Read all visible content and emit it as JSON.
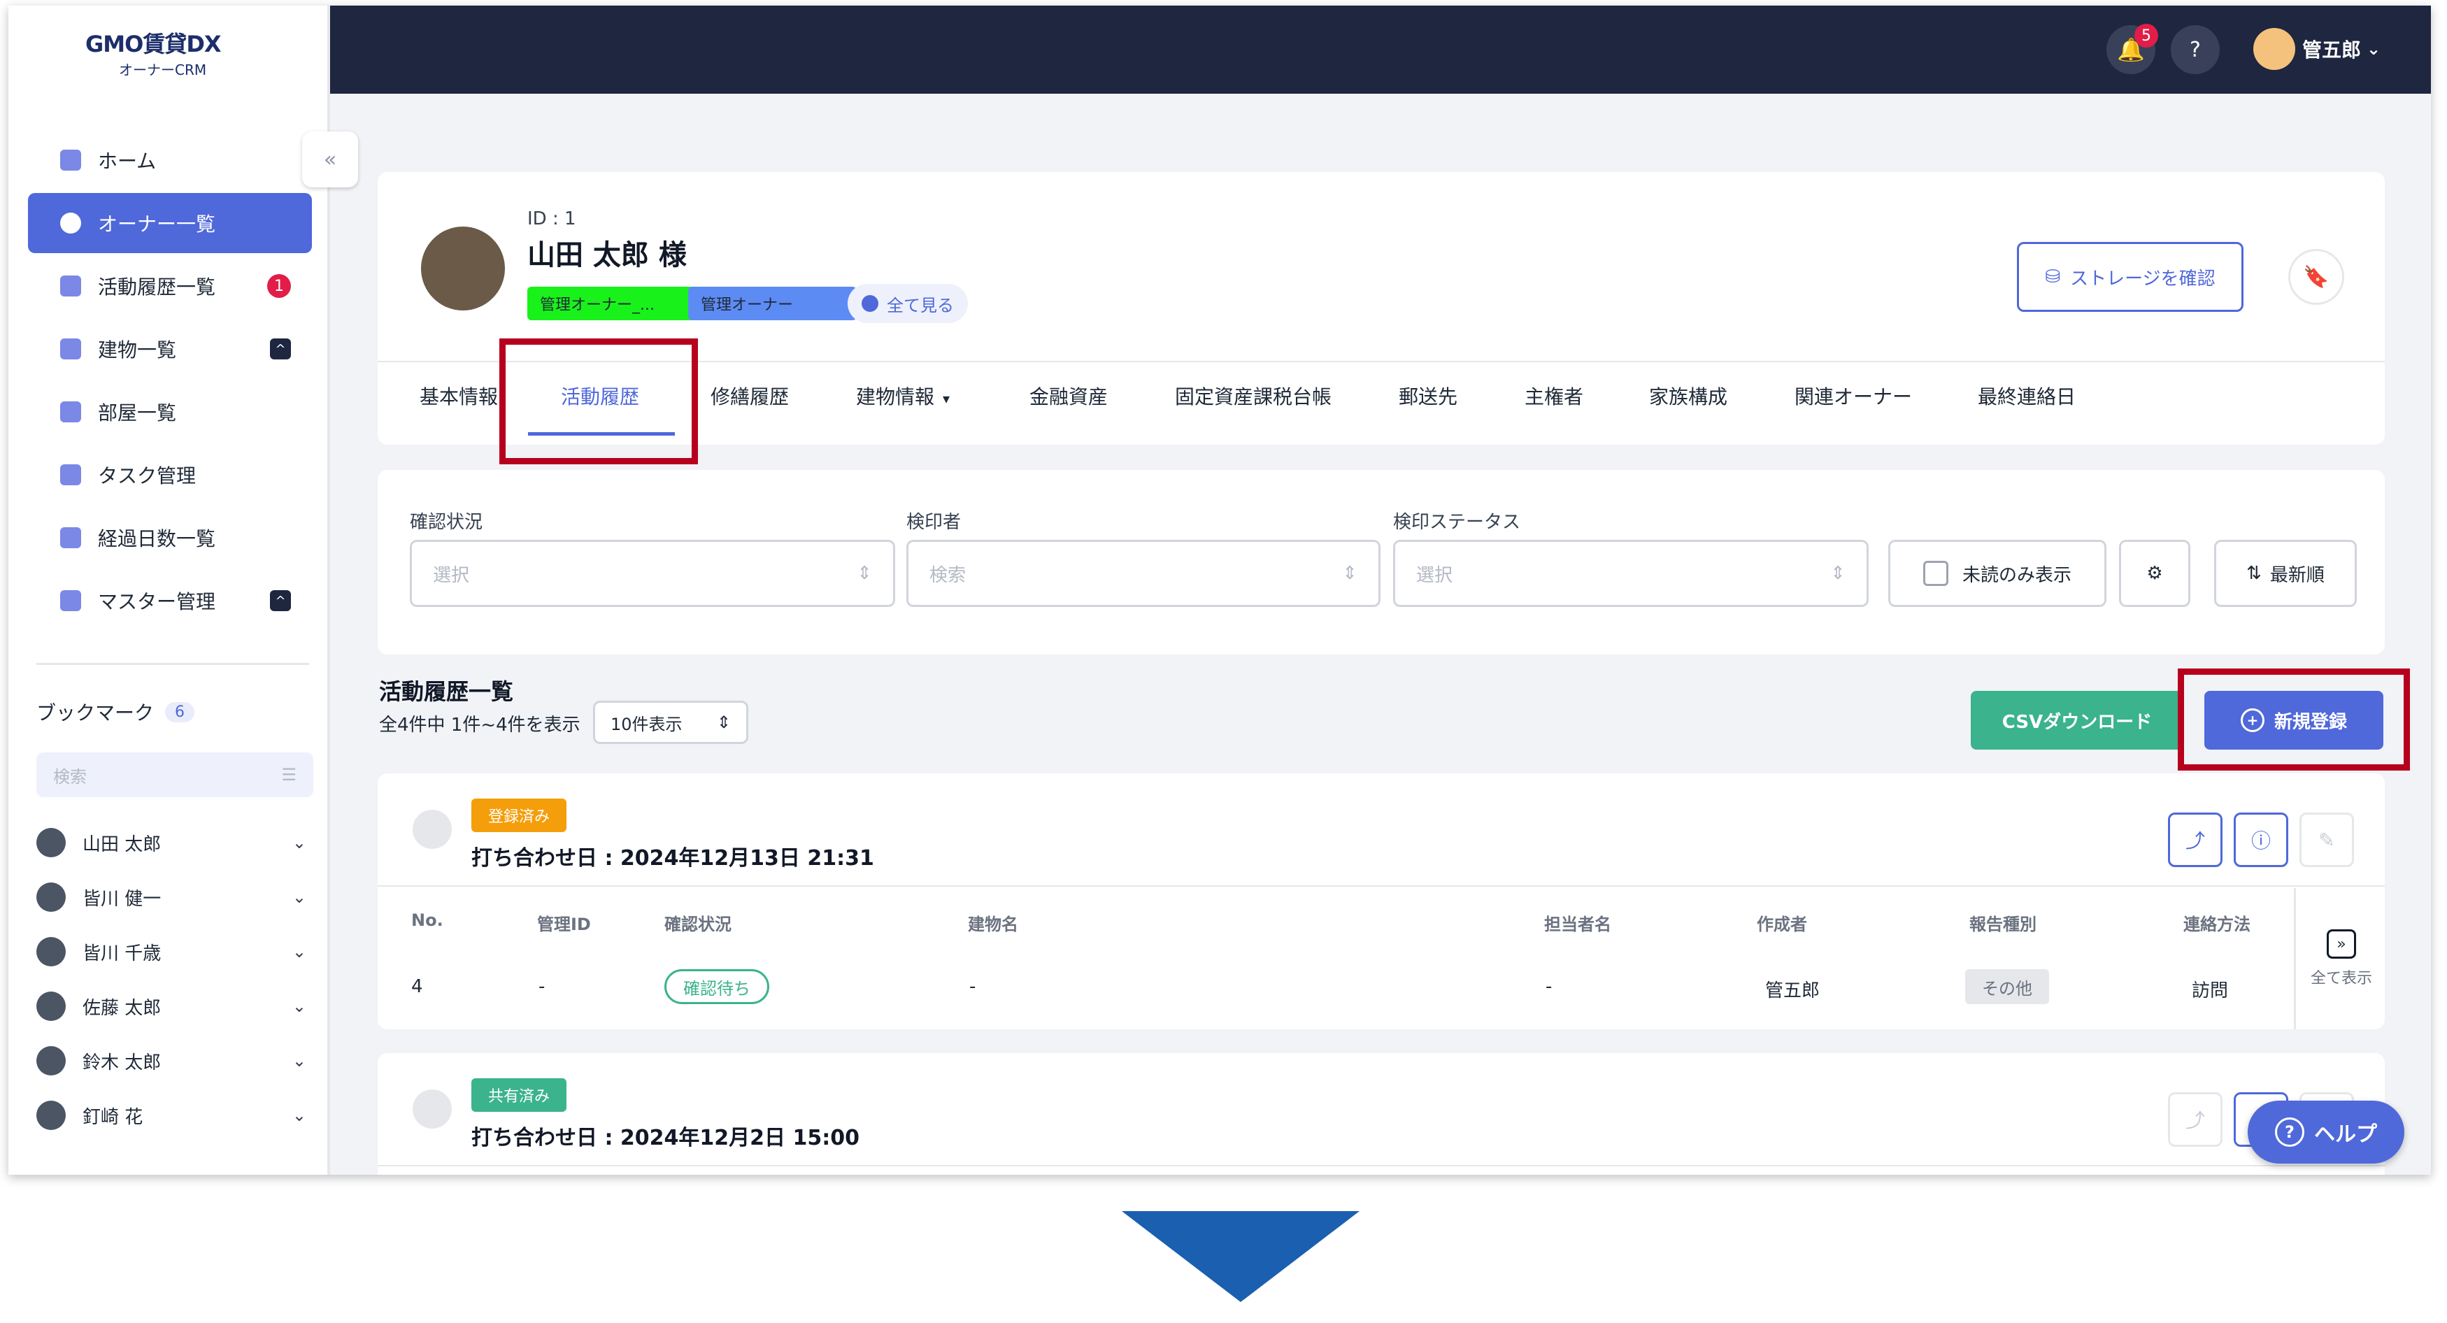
{
  "brand": {
    "logo": "GMO",
    "name": "賃貸DX",
    "sub": "オーナーCRM"
  },
  "sidebar": {
    "items": [
      {
        "label": "ホーム"
      },
      {
        "label": "オーナー一覧"
      },
      {
        "label": "活動履歴一覧",
        "badge": "1"
      },
      {
        "label": "建物一覧",
        "badge": "^"
      },
      {
        "label": "部屋一覧"
      },
      {
        "label": "タスク管理"
      },
      {
        "label": "経過日数一覧"
      },
      {
        "label": "マスター管理",
        "badge": "^"
      }
    ],
    "bookmarks_title": "ブックマーク",
    "bookmarks_count": "6",
    "search_placeholder": "検索",
    "bookmarks": [
      {
        "name": "山田 太郎"
      },
      {
        "name": "皆川 健一"
      },
      {
        "name": "皆川 千歳"
      },
      {
        "name": "佐藤 太郎"
      },
      {
        "name": "鈴木 太郎"
      },
      {
        "name": "釘崎 花"
      }
    ]
  },
  "header": {
    "notification_count": "5",
    "user_name": "管五郎"
  },
  "owner": {
    "id_label": "ID : 1",
    "name": "山田 太郎 様",
    "tags": [
      "管理オーナー_...",
      "管理オーナー"
    ],
    "see_all": "全て見る",
    "storage_button": "ストレージを確認"
  },
  "tabs": [
    "基本情報",
    "活動履歴",
    "修繕履歴",
    "建物情報",
    "金融資産",
    "固定資産課税台帳",
    "郵送先",
    "主権者",
    "家族構成",
    "関連オーナー",
    "最終連絡日"
  ],
  "filters": {
    "status_label": "確認状況",
    "status_placeholder": "選択",
    "inspector_label": "検印者",
    "inspector_placeholder": "検索",
    "stamp_label": "検印ステータス",
    "stamp_placeholder": "選択",
    "unread_only": "未読のみ表示",
    "sort": "最新順"
  },
  "list": {
    "title": "活動履歴一覧",
    "summary": "全4件中 1件~4件を表示",
    "per_page": "10件表示",
    "csv_button": "CSVダウンロード",
    "new_button": "新規登録"
  },
  "activities": [
    {
      "status": "登録済み",
      "meeting_date": "打ち合わせ日 : 2024年12月13日 21:31",
      "columns": [
        "No.",
        "管理ID",
        "確認状況",
        "建物名",
        "担当者名",
        "作成者",
        "報告種別",
        "連絡方法"
      ],
      "row": {
        "no": "4",
        "manage_id": "-",
        "confirm": "確認待ち",
        "building": "-",
        "staff": "-",
        "creator": "管五郎",
        "report_type": "その他",
        "contact": "訪問"
      },
      "expand_label": "全て表示"
    },
    {
      "status": "共有済み",
      "meeting_date": "打ち合わせ日 : 2024年12月2日 15:00"
    }
  ],
  "help_button": "ヘルプ"
}
